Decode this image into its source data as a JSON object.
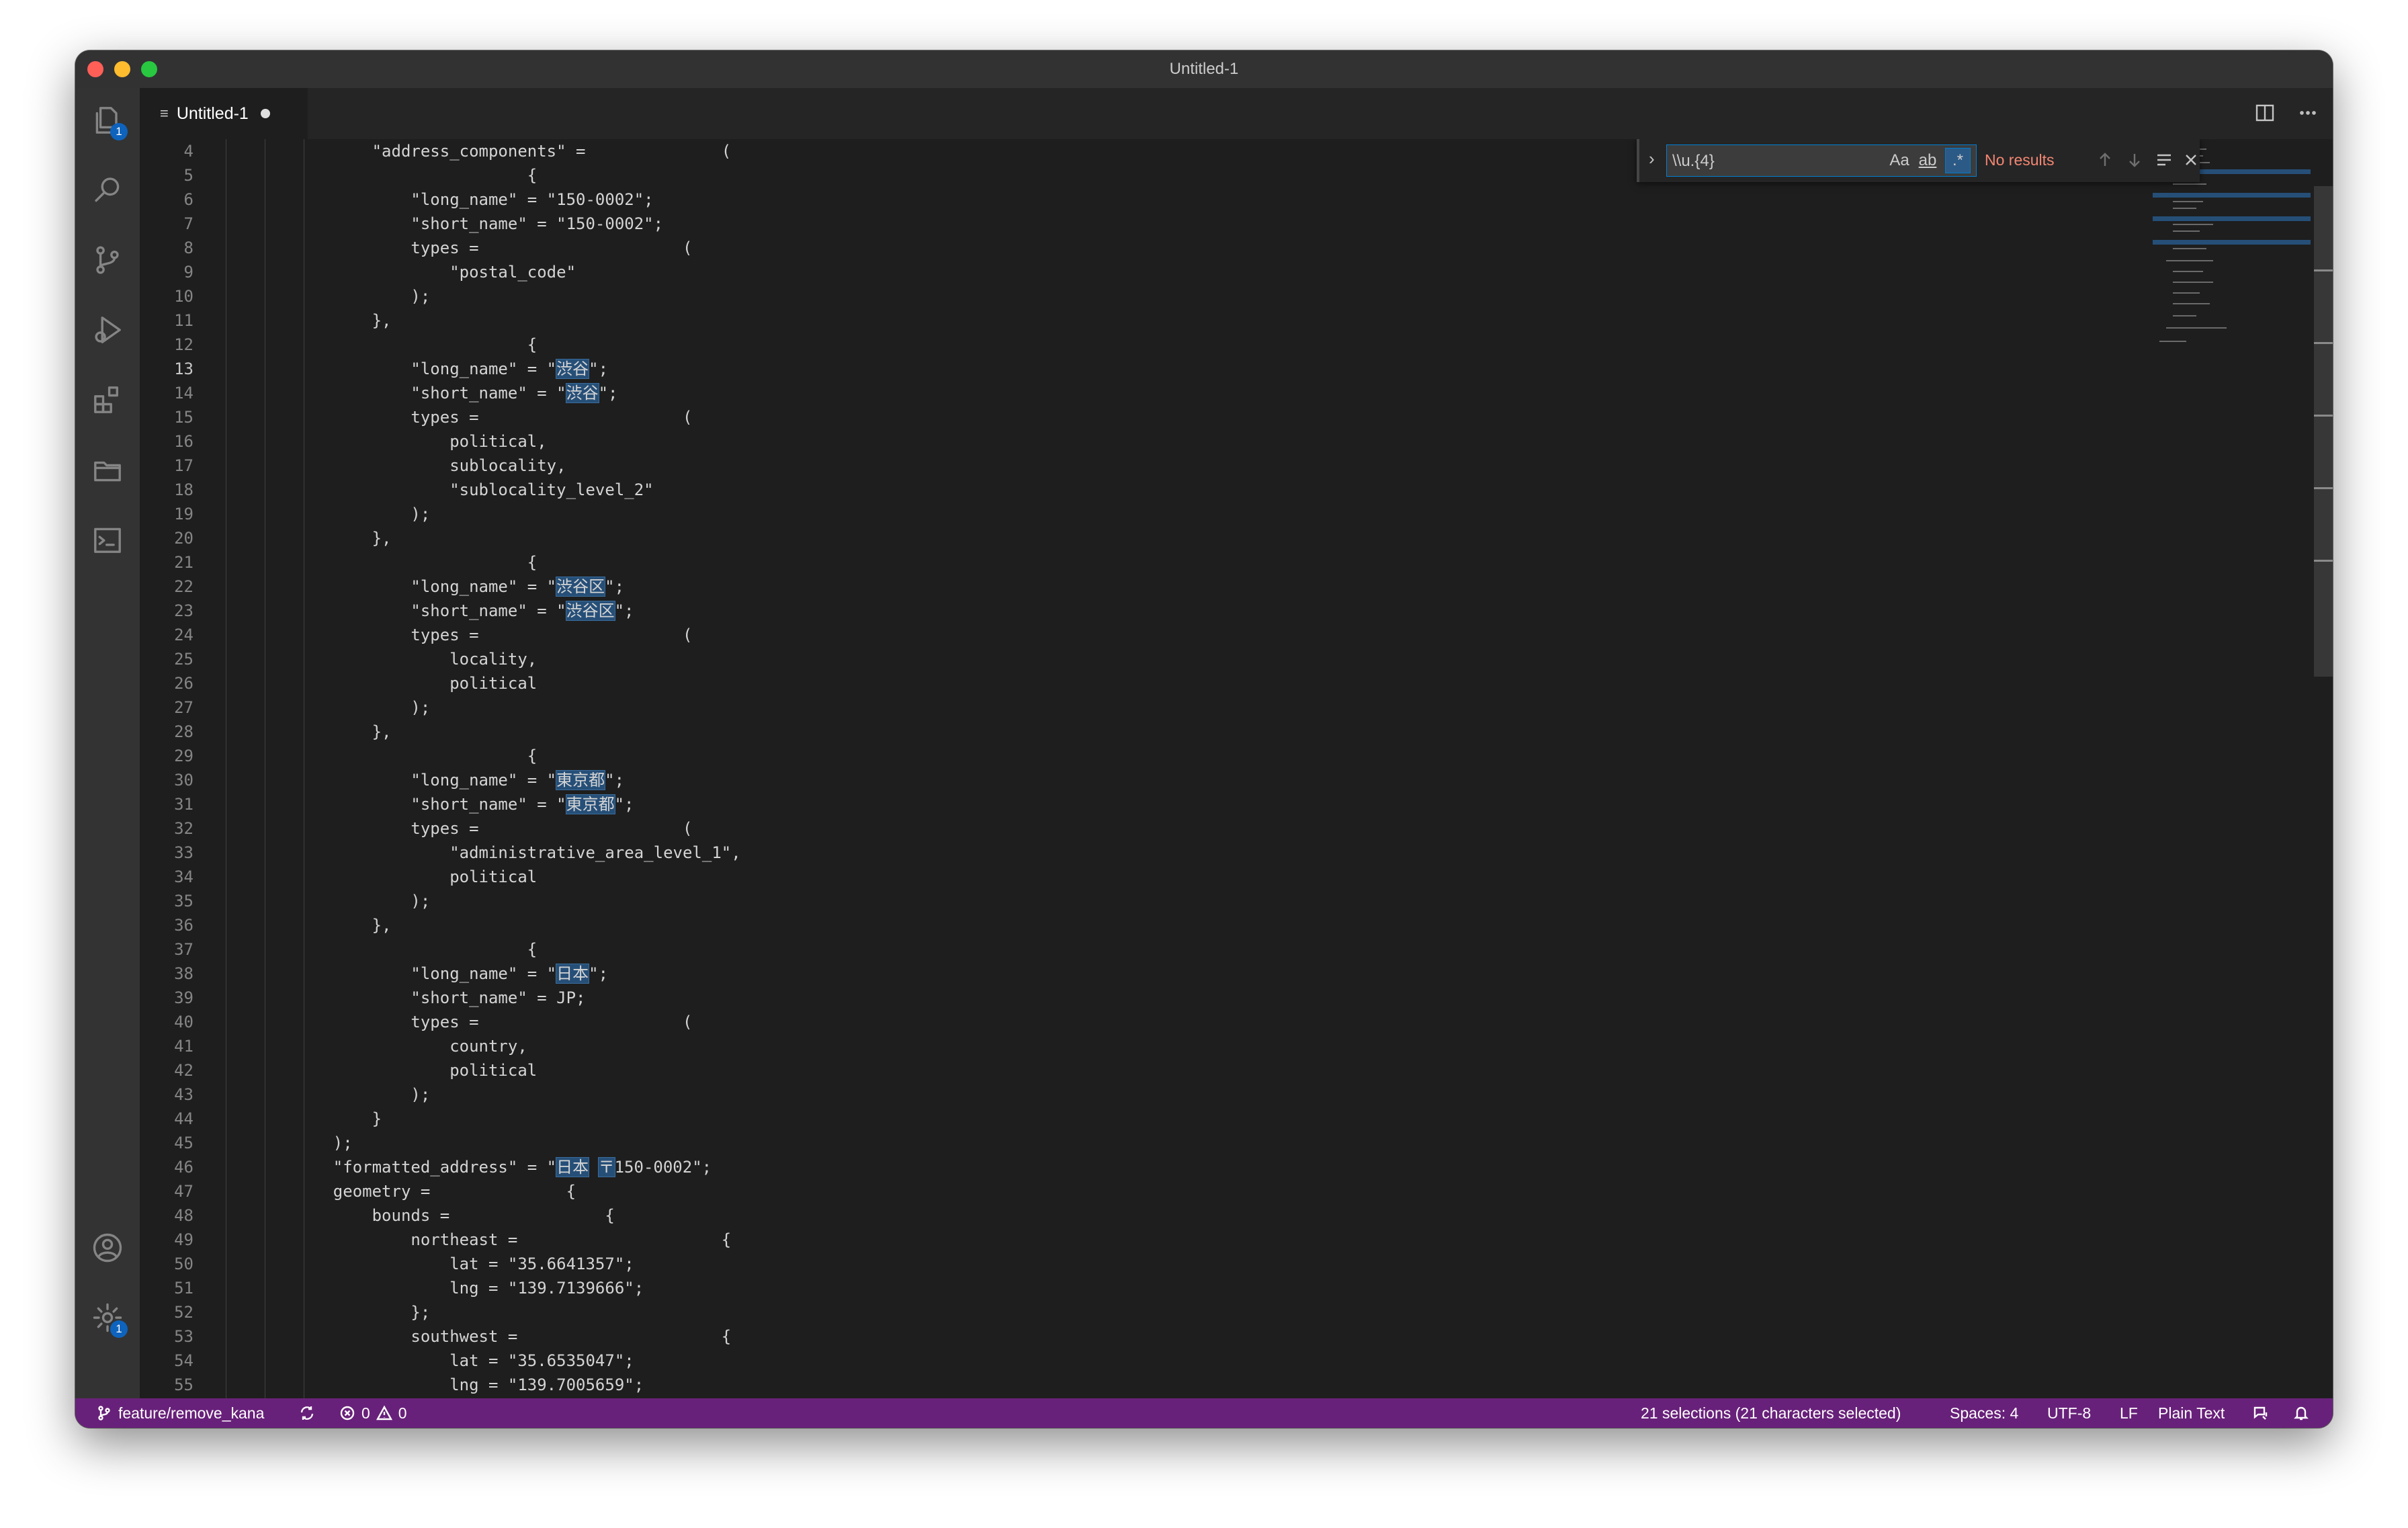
{
  "window": {
    "title": "Untitled-1"
  },
  "activity_bar": {
    "explorer_badge": "1",
    "settings_badge": "1"
  },
  "tab": {
    "label": "Untitled-1"
  },
  "find_widget": {
    "query": "\\\\u.{4}",
    "match_case_label": "Aa",
    "whole_word_label": "ab",
    "regex_label": ".*",
    "result_text": "No results"
  },
  "editor": {
    "active_line": "13",
    "lines": [
      {
        "n": "4",
        "segs": [
          {
            "t": "        \"address_components\" =              ("
          }
        ]
      },
      {
        "n": "5",
        "segs": [
          {
            "t": "                        {"
          }
        ]
      },
      {
        "n": "6",
        "segs": [
          {
            "t": "            \"long_name\" = \"150-0002\";"
          }
        ]
      },
      {
        "n": "7",
        "segs": [
          {
            "t": "            \"short_name\" = \"150-0002\";"
          }
        ]
      },
      {
        "n": "8",
        "segs": [
          {
            "t": "            types =                     ("
          }
        ]
      },
      {
        "n": "9",
        "segs": [
          {
            "t": "                \"postal_code\""
          }
        ]
      },
      {
        "n": "10",
        "segs": [
          {
            "t": "            );"
          }
        ]
      },
      {
        "n": "11",
        "segs": [
          {
            "t": "        },"
          }
        ]
      },
      {
        "n": "12",
        "segs": [
          {
            "t": "                        {"
          }
        ]
      },
      {
        "n": "13",
        "segs": [
          {
            "t": "            \"long_name\" = \""
          },
          {
            "t": "渋谷",
            "h": true
          },
          {
            "t": "\";"
          }
        ]
      },
      {
        "n": "14",
        "segs": [
          {
            "t": "            \"short_name\" = \""
          },
          {
            "t": "渋谷",
            "h": true
          },
          {
            "t": "\";"
          }
        ]
      },
      {
        "n": "15",
        "segs": [
          {
            "t": "            types =                     ("
          }
        ]
      },
      {
        "n": "16",
        "segs": [
          {
            "t": "                political,"
          }
        ]
      },
      {
        "n": "17",
        "segs": [
          {
            "t": "                sublocality,"
          }
        ]
      },
      {
        "n": "18",
        "segs": [
          {
            "t": "                \"sublocality_level_2\""
          }
        ]
      },
      {
        "n": "19",
        "segs": [
          {
            "t": "            );"
          }
        ]
      },
      {
        "n": "20",
        "segs": [
          {
            "t": "        },"
          }
        ]
      },
      {
        "n": "21",
        "segs": [
          {
            "t": "                        {"
          }
        ]
      },
      {
        "n": "22",
        "segs": [
          {
            "t": "            \"long_name\" = \""
          },
          {
            "t": "渋谷区",
            "h": true
          },
          {
            "t": "\";"
          }
        ]
      },
      {
        "n": "23",
        "segs": [
          {
            "t": "            \"short_name\" = \""
          },
          {
            "t": "渋谷区",
            "h": true
          },
          {
            "t": "\";"
          }
        ]
      },
      {
        "n": "24",
        "segs": [
          {
            "t": "            types =                     ("
          }
        ]
      },
      {
        "n": "25",
        "segs": [
          {
            "t": "                locality,"
          }
        ]
      },
      {
        "n": "26",
        "segs": [
          {
            "t": "                political"
          }
        ]
      },
      {
        "n": "27",
        "segs": [
          {
            "t": "            );"
          }
        ]
      },
      {
        "n": "28",
        "segs": [
          {
            "t": "        },"
          }
        ]
      },
      {
        "n": "29",
        "segs": [
          {
            "t": "                        {"
          }
        ]
      },
      {
        "n": "30",
        "segs": [
          {
            "t": "            \"long_name\" = \""
          },
          {
            "t": "東京都",
            "h": true
          },
          {
            "t": "\";"
          }
        ]
      },
      {
        "n": "31",
        "segs": [
          {
            "t": "            \"short_name\" = \""
          },
          {
            "t": "東京都",
            "h": true
          },
          {
            "t": "\";"
          }
        ]
      },
      {
        "n": "32",
        "segs": [
          {
            "t": "            types =                     ("
          }
        ]
      },
      {
        "n": "33",
        "segs": [
          {
            "t": "                \"administrative_area_level_1\","
          }
        ]
      },
      {
        "n": "34",
        "segs": [
          {
            "t": "                political"
          }
        ]
      },
      {
        "n": "35",
        "segs": [
          {
            "t": "            );"
          }
        ]
      },
      {
        "n": "36",
        "segs": [
          {
            "t": "        },"
          }
        ]
      },
      {
        "n": "37",
        "segs": [
          {
            "t": "                        {"
          }
        ]
      },
      {
        "n": "38",
        "segs": [
          {
            "t": "            \"long_name\" = \""
          },
          {
            "t": "日本",
            "h": true
          },
          {
            "t": "\";"
          }
        ]
      },
      {
        "n": "39",
        "segs": [
          {
            "t": "            \"short_name\" = JP;"
          }
        ]
      },
      {
        "n": "40",
        "segs": [
          {
            "t": "            types =                     ("
          }
        ]
      },
      {
        "n": "41",
        "segs": [
          {
            "t": "                country,"
          }
        ]
      },
      {
        "n": "42",
        "segs": [
          {
            "t": "                political"
          }
        ]
      },
      {
        "n": "43",
        "segs": [
          {
            "t": "            );"
          }
        ]
      },
      {
        "n": "44",
        "segs": [
          {
            "t": "        }"
          }
        ]
      },
      {
        "n": "45",
        "segs": [
          {
            "t": "    );"
          }
        ]
      },
      {
        "n": "46",
        "segs": [
          {
            "t": "    \"formatted_address\" = \""
          },
          {
            "t": "日本",
            "h": true
          },
          {
            "t": " "
          },
          {
            "t": "〒",
            "h": true
          },
          {
            "t": "150-0002\";"
          }
        ]
      },
      {
        "n": "47",
        "segs": [
          {
            "t": "    geometry =              {"
          }
        ]
      },
      {
        "n": "48",
        "segs": [
          {
            "t": "        bounds =                {"
          }
        ]
      },
      {
        "n": "49",
        "segs": [
          {
            "t": "            northeast =                     {"
          }
        ]
      },
      {
        "n": "50",
        "segs": [
          {
            "t": "                lat = \"35.6641357\";"
          }
        ]
      },
      {
        "n": "51",
        "segs": [
          {
            "t": "                lng = \"139.7139666\";"
          }
        ]
      },
      {
        "n": "52",
        "segs": [
          {
            "t": "            };"
          }
        ]
      },
      {
        "n": "53",
        "segs": [
          {
            "t": "            southwest =                     {"
          }
        ]
      },
      {
        "n": "54",
        "segs": [
          {
            "t": "                lat = \"35.6535047\";"
          }
        ]
      },
      {
        "n": "55",
        "segs": [
          {
            "t": "                lng = \"139.7005659\";"
          }
        ]
      }
    ]
  },
  "status_bar": {
    "branch": "feature/remove_kana",
    "errors": "0",
    "warnings": "0",
    "selections": "21 selections (21 characters selected)",
    "spaces": "Spaces: 4",
    "encoding": "UTF-8",
    "eol": "LF",
    "language": "Plain Text"
  }
}
